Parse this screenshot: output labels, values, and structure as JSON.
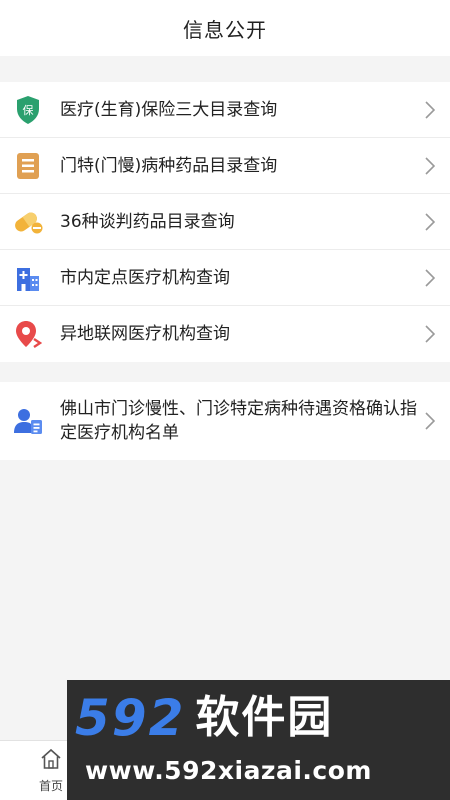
{
  "header": {
    "title": "信息公开"
  },
  "accent": "#2aa06e",
  "list1": [
    {
      "label": "医疗(生育)保险三大目录查询",
      "icon": "insurance-shield-icon",
      "icon_text": "保"
    },
    {
      "label": "门特(门慢)病种药品目录查询",
      "icon": "document-list-icon"
    },
    {
      "label": "36种谈判药品目录查询",
      "icon": "pill-capsule-icon"
    },
    {
      "label": "市内定点医疗机构查询",
      "icon": "hospital-building-icon"
    },
    {
      "label": "异地联网医疗机构查询",
      "icon": "location-pin-icon"
    }
  ],
  "list2": [
    {
      "label": "佛山市门诊慢性、门诊特定病种待遇资格确认指定医疗机构名单",
      "icon": "person-document-icon"
    }
  ],
  "tabbar": {
    "home_label": "首页"
  },
  "watermark": {
    "logo_num": "592",
    "logo_cn": "软件园",
    "url": "www.592xiazai.com"
  }
}
